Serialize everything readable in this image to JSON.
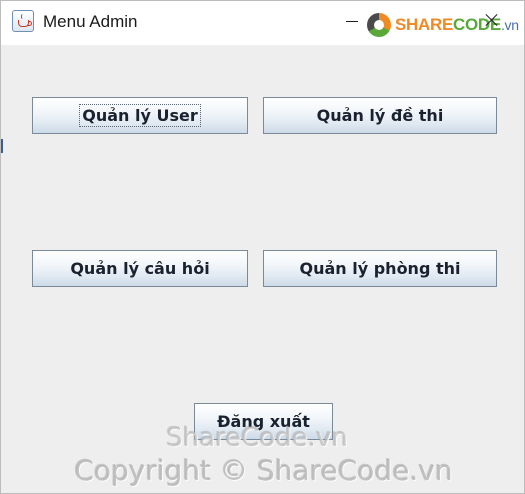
{
  "window": {
    "title": "Menu Admin"
  },
  "logo": {
    "share": "SHARE",
    "code": "CODE",
    "vn": ".vn"
  },
  "buttons": {
    "manage_user": "Quản lý User",
    "manage_exam": "Quản lý đề thi",
    "manage_questions": "Quản lý câu hỏi",
    "manage_rooms": "Quản lý phòng thi",
    "logout": "Đăng xuất"
  },
  "watermark": {
    "line1": "ShareCode.vn",
    "line2": "Copyright © ShareCode.vn"
  },
  "icons": {
    "app": "java-cup-icon",
    "minimize": "minimize-icon",
    "close": "close-icon"
  },
  "colors": {
    "panel_background": "#eeeeee",
    "button_border": "#7a8a99",
    "logo_orange": "#f08a24",
    "logo_green": "#5aa83a"
  }
}
